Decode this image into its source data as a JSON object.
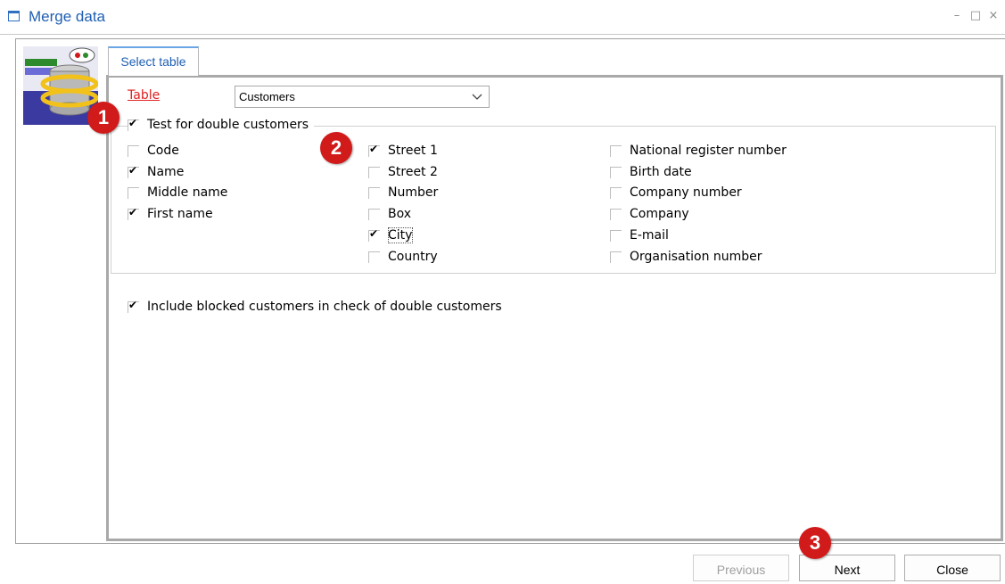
{
  "window": {
    "title": "Merge data"
  },
  "tabs": [
    {
      "label": "Select table"
    }
  ],
  "table": {
    "label": "Table",
    "selected": "Customers"
  },
  "double_test": {
    "label": "Test for double customers",
    "checked": true
  },
  "fields": {
    "col1": [
      {
        "label": "Code",
        "checked": false
      },
      {
        "label": "Name",
        "checked": true
      },
      {
        "label": "Middle name",
        "checked": false
      },
      {
        "label": "First name",
        "checked": true
      }
    ],
    "col2": [
      {
        "label": "Street 1",
        "checked": true
      },
      {
        "label": "Street 2",
        "checked": false
      },
      {
        "label": "Number",
        "checked": false
      },
      {
        "label": "Box",
        "checked": false
      },
      {
        "label": "City",
        "checked": true
      },
      {
        "label": "Country",
        "checked": false
      }
    ],
    "col3": [
      {
        "label": "National register number",
        "checked": false
      },
      {
        "label": "Birth date",
        "checked": false
      },
      {
        "label": "Company number",
        "checked": false
      },
      {
        "label": "Company",
        "checked": false
      },
      {
        "label": "E-mail",
        "checked": false
      },
      {
        "label": "Organisation number",
        "checked": false
      }
    ]
  },
  "include_blocked": {
    "label": "Include blocked customers in check of double customers",
    "checked": true
  },
  "badges": [
    "1",
    "2",
    "3"
  ],
  "buttons": {
    "previous": "Previous",
    "next": "Next",
    "close": "Close"
  },
  "colors": {
    "accent": "#1f5fb3",
    "badge": "#d11a1a",
    "table_label": "#e02020"
  }
}
